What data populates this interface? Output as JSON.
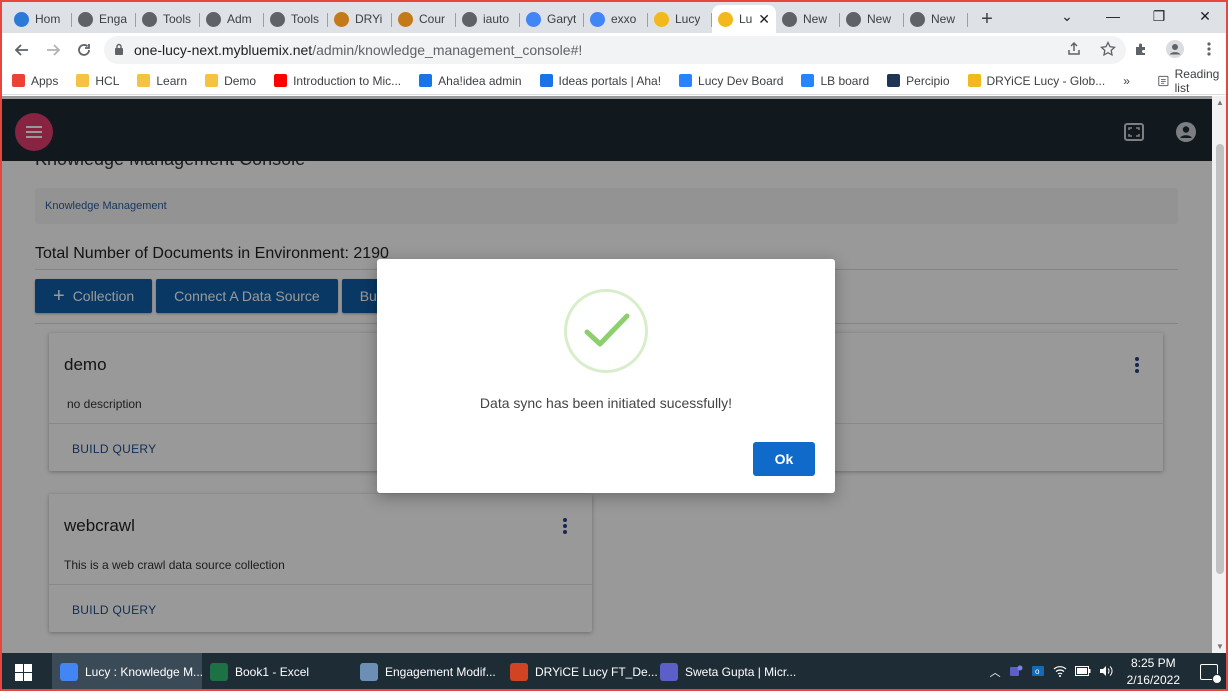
{
  "browser": {
    "tabs": [
      {
        "label": "Hom",
        "icon": "site-icon",
        "color": "#2b7bd6"
      },
      {
        "label": "Enga",
        "icon": "chrome-icon",
        "color": "#5f6368"
      },
      {
        "label": "Tools",
        "icon": "chrome-icon",
        "color": "#5f6368"
      },
      {
        "label": "Adm",
        "icon": "chrome-icon",
        "color": "#5f6368"
      },
      {
        "label": "Tools",
        "icon": "chrome-icon",
        "color": "#5f6368"
      },
      {
        "label": "DRYi",
        "icon": "dryice-icon",
        "color": "#c47a1a"
      },
      {
        "label": "Cour",
        "icon": "dryice-icon",
        "color": "#c47a1a"
      },
      {
        "label": "iauto",
        "icon": "chrome-icon",
        "color": "#5f6368"
      },
      {
        "label": "Garyt",
        "icon": "google-icon",
        "color": "#4285f4"
      },
      {
        "label": "exxo",
        "icon": "google-icon",
        "color": "#4285f4"
      },
      {
        "label": "Lucy",
        "icon": "lucy-icon",
        "color": "#f2b81c"
      },
      {
        "label": "Lu",
        "icon": "lucy-icon",
        "color": "#f2b81c",
        "active": true
      },
      {
        "label": "New",
        "icon": "chrome-icon",
        "color": "#5f6368"
      },
      {
        "label": "New",
        "icon": "chrome-icon",
        "color": "#5f6368"
      },
      {
        "label": "New",
        "icon": "chrome-icon",
        "color": "#5f6368"
      }
    ],
    "new_tab": "+",
    "window_controls": {
      "dropdown": "⌄",
      "minimize": "—",
      "restore": "❐",
      "close": "✕"
    },
    "url": {
      "host": "one-lucy-next.mybluemix.net",
      "path": "/admin/knowledge_management_console#!"
    },
    "bookmarks": [
      {
        "label": "Apps",
        "color": "#ea4335"
      },
      {
        "label": "HCL",
        "color": "#f5c242"
      },
      {
        "label": "Learn",
        "color": "#f5c242"
      },
      {
        "label": "Demo",
        "color": "#f5c242"
      },
      {
        "label": "Introduction to Mic...",
        "color": "#ff0000"
      },
      {
        "label": "Aha!idea admin",
        "color": "#1a73e8"
      },
      {
        "label": "Ideas portals | Aha!",
        "color": "#1a73e8"
      },
      {
        "label": "Lucy Dev Board",
        "color": "#2684ff"
      },
      {
        "label": "LB board",
        "color": "#2684ff"
      },
      {
        "label": "Percipio",
        "color": "#1d3557"
      },
      {
        "label": "DRYiCE Lucy - Glob...",
        "color": "#f2b81c"
      }
    ],
    "bookmarks_more": "»",
    "reading_list": "Reading list"
  },
  "app": {
    "page_title": "Knowledge Management Console",
    "breadcrumb": "Knowledge Management",
    "total_documents": "Total Number of Documents in Environment: 2190",
    "buttons": {
      "collection": "Collection",
      "connect": "Connect A Data Source",
      "build": "Build"
    },
    "collections": [
      {
        "title": "demo",
        "description": "no description",
        "action": "BUILD QUERY"
      },
      {
        "title": "webcrawl",
        "description": "This is a web crawl data source collection",
        "action": "BUILD QUERY"
      }
    ]
  },
  "modal": {
    "message": "Data sync has been initiated sucessfully!",
    "ok_label": "Ok",
    "check_color": "#8ccf6c"
  },
  "taskbar": {
    "apps": [
      {
        "label": "Lucy : Knowledge M...",
        "icon": "chrome-icon",
        "color": "#4285f4",
        "active": true
      },
      {
        "label": "Book1 - Excel",
        "icon": "excel-icon",
        "color": "#1e7145"
      },
      {
        "label": "Engagement Modif...",
        "icon": "paint-icon",
        "color": "#6b8fb5"
      },
      {
        "label": "DRYiCE Lucy FT_De...",
        "icon": "powerpoint-icon",
        "color": "#d04423"
      },
      {
        "label": "Sweta Gupta | Micr...",
        "icon": "teams-icon",
        "color": "#5b5fc7"
      }
    ],
    "time": "8:25 PM",
    "date": "2/16/2022"
  }
}
